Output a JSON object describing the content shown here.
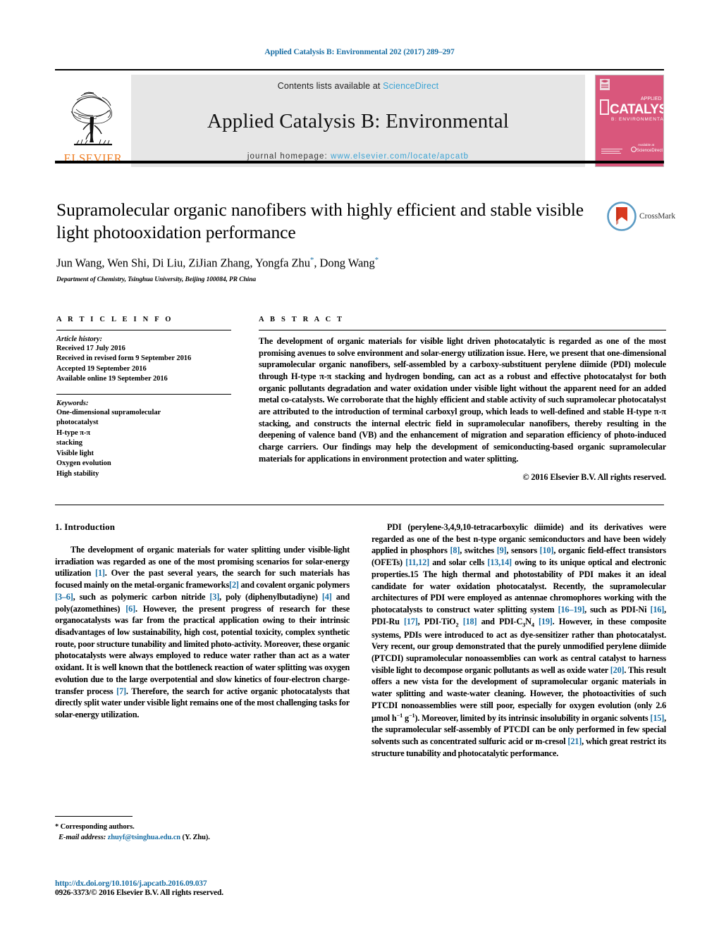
{
  "running_head": "Applied Catalysis B: Environmental 202 (2017) 289–297",
  "masthead": {
    "contents_prefix": "Contents lists available at ",
    "sciencedirect": "ScienceDirect",
    "journal_title": "Applied Catalysis B: Environmental",
    "homepage_prefix": "journal homepage: ",
    "homepage_url": "www.elsevier.com/locate/apcatb",
    "publisher": "ELSEVIER",
    "cover_title": "CATALYSIS",
    "cover_subtitle": "B: ENVIRONMENTAL",
    "link_color": "#3aa3d4",
    "band_color": "#e6e6e6",
    "cover_color": "#d9577c",
    "elsevier_orange": "#ef7d22"
  },
  "article": {
    "title": "Supramolecular organic nanofibers with highly efficient and stable visible light photooxidation performance",
    "authors_html": "Jun Wang, Wen Shi, Di Liu, ZiJian Zhang, Yongfa Zhu<sup>*</sup>, Dong Wang<sup>*</sup>",
    "affiliation": "Department of Chemistry, Tsinghua University, Beijing 100084, PR China",
    "crossmark_label": "CrossMark"
  },
  "article_info": {
    "heading": "A R T I C L E   I N F O",
    "history_label": "Article history:",
    "history": [
      "Received 17 July 2016",
      "Received in revised form 9 September 2016",
      "Accepted 19 September 2016",
      "Available online 19 September 2016"
    ],
    "keywords_label": "Keywords:",
    "keywords": [
      "One-dimensional supramolecular",
      "photocatalyst",
      "H-type π-π",
      "stacking",
      "Visible light",
      "Oxygen evolution",
      "High stability"
    ]
  },
  "abstract": {
    "heading": "A B S T R A C T",
    "text": "The development of organic materials for visible light driven photocatalytic is regarded as one of the most promising avenues to solve environment and solar-energy utilization issue. Here, we present that one-dimensional supramolecular organic nanofibers, self-assembled by a carboxy-substituent perylene diimide (PDI) molecule through H-type π-π stacking and hydrogen bonding, can act as a robust and effective photocatalyst for both organic pollutants degradation and water oxidation under visible light without the apparent need for an added metal co-catalysts. We corroborate that the highly efficient and stable activity of such supramolecar photocatalyst are attributed to the introduction of terminal carboxyl group, which leads to well-defined and stable H-type π-π stacking, and constructs the internal electric field in supramolecular nanofibers, thereby resulting in the deepening of valence band (VB) and the enhancement of migration and separation efficiency of photo-induced charge carriers. Our findings may help the development of semiconducting-based organic supramolecular materials for applications in environment protection and water splitting.",
    "copyright": "© 2016 Elsevier B.V. All rights reserved."
  },
  "body": {
    "section_number_title": "1.  Introduction",
    "left_paragraph_1_html": "The development of organic materials for water splitting under visible-light irradiation was regarded as one of the most promising scenarios for solar-energy utilization <span class=\"ref\">[1]</span>. Over the past several years, the search for such materials has focused mainly on the metal-organic frameworks<span class=\"ref\">[2]</span> and covalent organic polymers <span class=\"ref\">[3–6]</span>, such as polymeric carbon nitride <span class=\"ref\">[3]</span>, poly (diphenylbutadiyne) <span class=\"ref\">[4]</span> and poly(azomethines) <span class=\"ref\">[6]</span>. However, the present progress of research for these organocatalysts was far from the practical application owing to their intrinsic disadvantages of low sustainability, high cost, potential toxicity, complex synthetic route, poor structure tunability and limited photo-activity. Moreover, these organic photocatalysts were always employed to reduce water rather than act as a water oxidant. It is well known that the bottleneck reaction of water splitting was oxygen evolution due to the large overpotential and slow kinetics of four-electron charge-transfer process <span class=\"ref\">[7]</span>. Therefore, the search for active organic photocatalysts that directly split water under visible light remains one of the most challenging tasks for solar-energy utilization.",
    "right_paragraph_1_html": "PDI (perylene-3,4,9,10-tetracarboxylic diimide) and its derivatives were regarded as one of the best n-type organic semiconductors and have been widely applied in phosphors <span class=\"ref\">[8]</span>, switches <span class=\"ref\">[9]</span>, sensors <span class=\"ref\">[10]</span>, organic field-effect transistors (OFETs) <span class=\"ref\">[11,12]</span> and solar cells <span class=\"ref\">[13,14]</span> owing to its unique optical and electronic properties.15 The high thermal and photostability of PDI makes it an ideal candidate for water oxidation photocatalyst. Recently, the supramolecular architectures of PDI were employed as antennae chromophores working with the photocatalysts to construct water splitting system <span class=\"ref\">[16–19]</span>, such as PDI-Ni <span class=\"ref\">[16]</span>, PDI-Ru <span class=\"ref\">[17]</span>, PDI-TiO<sub>2</sub> <span class=\"ref\">[18]</span> and PDI-C<sub>3</sub>N<sub>4</sub> <span class=\"ref\">[19]</span>. However, in these composite systems, PDIs were introduced to act as dye-sensitizer rather than photocatalyst. Very recent, our group demonstrated that the purely unmodified perylene diimide (PTCDI) supramolecular nonoassemblies can work as central catalyst to harness visible light to decompose organic pollutants as well as oxide water <span class=\"ref\">[20]</span>. This result offers a new vista for the development of supramolecular organic materials in water splitting and waste-water cleaning. However, the photoactivities of such PTCDI nonoassemblies were still poor, especially for oxygen evolution (only 2.6 μmol h<sup>−1</sup> g<sup>−1</sup>). Moreover, limited by its intrinsic insolubility in organic solvents <span class=\"ref\">[15]</span>, the supramolecular self-assembly of PTCDI can be only performed in few special solvents such as concentrated sulfuric acid or m-cresol <span class=\"ref\">[21]</span>, which great restrict its structure tunability and photocatalytic performance."
  },
  "footnote": {
    "corresponding": "*  Corresponding authors.",
    "email_label": "E-mail address:",
    "email": "zhuyf@tsinghua.edu.cn",
    "email_suffix": "(Y. Zhu).",
    "doi": "http://dx.doi.org/10.1016/j.apcatb.2016.09.037",
    "issn": "0926-3373/© 2016 Elsevier B.V. All rights reserved."
  }
}
